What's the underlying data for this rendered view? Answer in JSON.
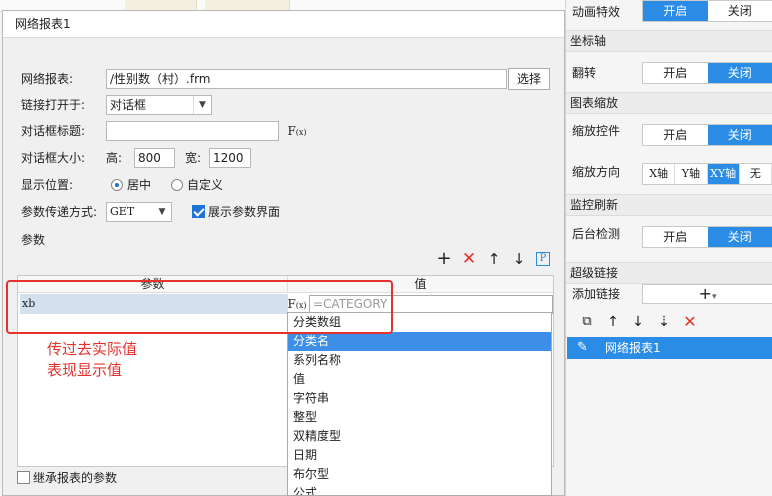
{
  "dialog": {
    "title": "网络报表1",
    "report_label": "网络报表:",
    "report_value": "/性别数（村）.frm",
    "select_button": "选择",
    "open_in_label": "链接打开于:",
    "open_in_value": "对话框",
    "dlg_title_label": "对话框标题:",
    "dlg_size_label": "对话框大小:",
    "height_label": "高:",
    "height_value": "800",
    "width_label": "宽:",
    "width_value": "1200",
    "position_label": "显示位置:",
    "position_center": "居中",
    "position_custom": "自定义",
    "param_method_label": "参数传递方式:",
    "param_method_value": "GET",
    "show_param_ui": "展示参数界面",
    "params_label": "参数",
    "col_param": "参数",
    "col_value": "值",
    "param_name": "xb",
    "value_placeholder": "=CATEGORY",
    "inherit_label": "继承报表的参数",
    "fx_label": "F",
    "fx_sub": "(x)"
  },
  "dropdown": {
    "items": [
      "分类数组",
      "分类名",
      "系列名称",
      "值",
      "字符串",
      "整型",
      "双精度型",
      "日期",
      "布尔型",
      "公式"
    ],
    "selected_index": 1
  },
  "annotation": {
    "line1": "传过去实际值",
    "line2": "表现显示值"
  },
  "right_panel": {
    "anim_label": "动画特效",
    "on": "开启",
    "off": "关闭",
    "axis_section": "坐标轴",
    "flip_label": "翻转",
    "zoom_section": "图表缩放",
    "zoom_ctrl_label": "缩放控件",
    "zoom_dir_label": "缩放方向",
    "dir_x": "X轴",
    "dir_y": "Y轴",
    "dir_xy": "XY轴",
    "dir_none": "无",
    "refresh_section": "监控刷新",
    "bg_detect_label": "后台检测",
    "link_section": "超级链接",
    "add_link_label": "添加链接",
    "link_item": "网络报表1"
  },
  "colors": {
    "accent": "#2b8ce6",
    "annotation_red": "#e5322d",
    "delete_red": "#e5322d"
  }
}
